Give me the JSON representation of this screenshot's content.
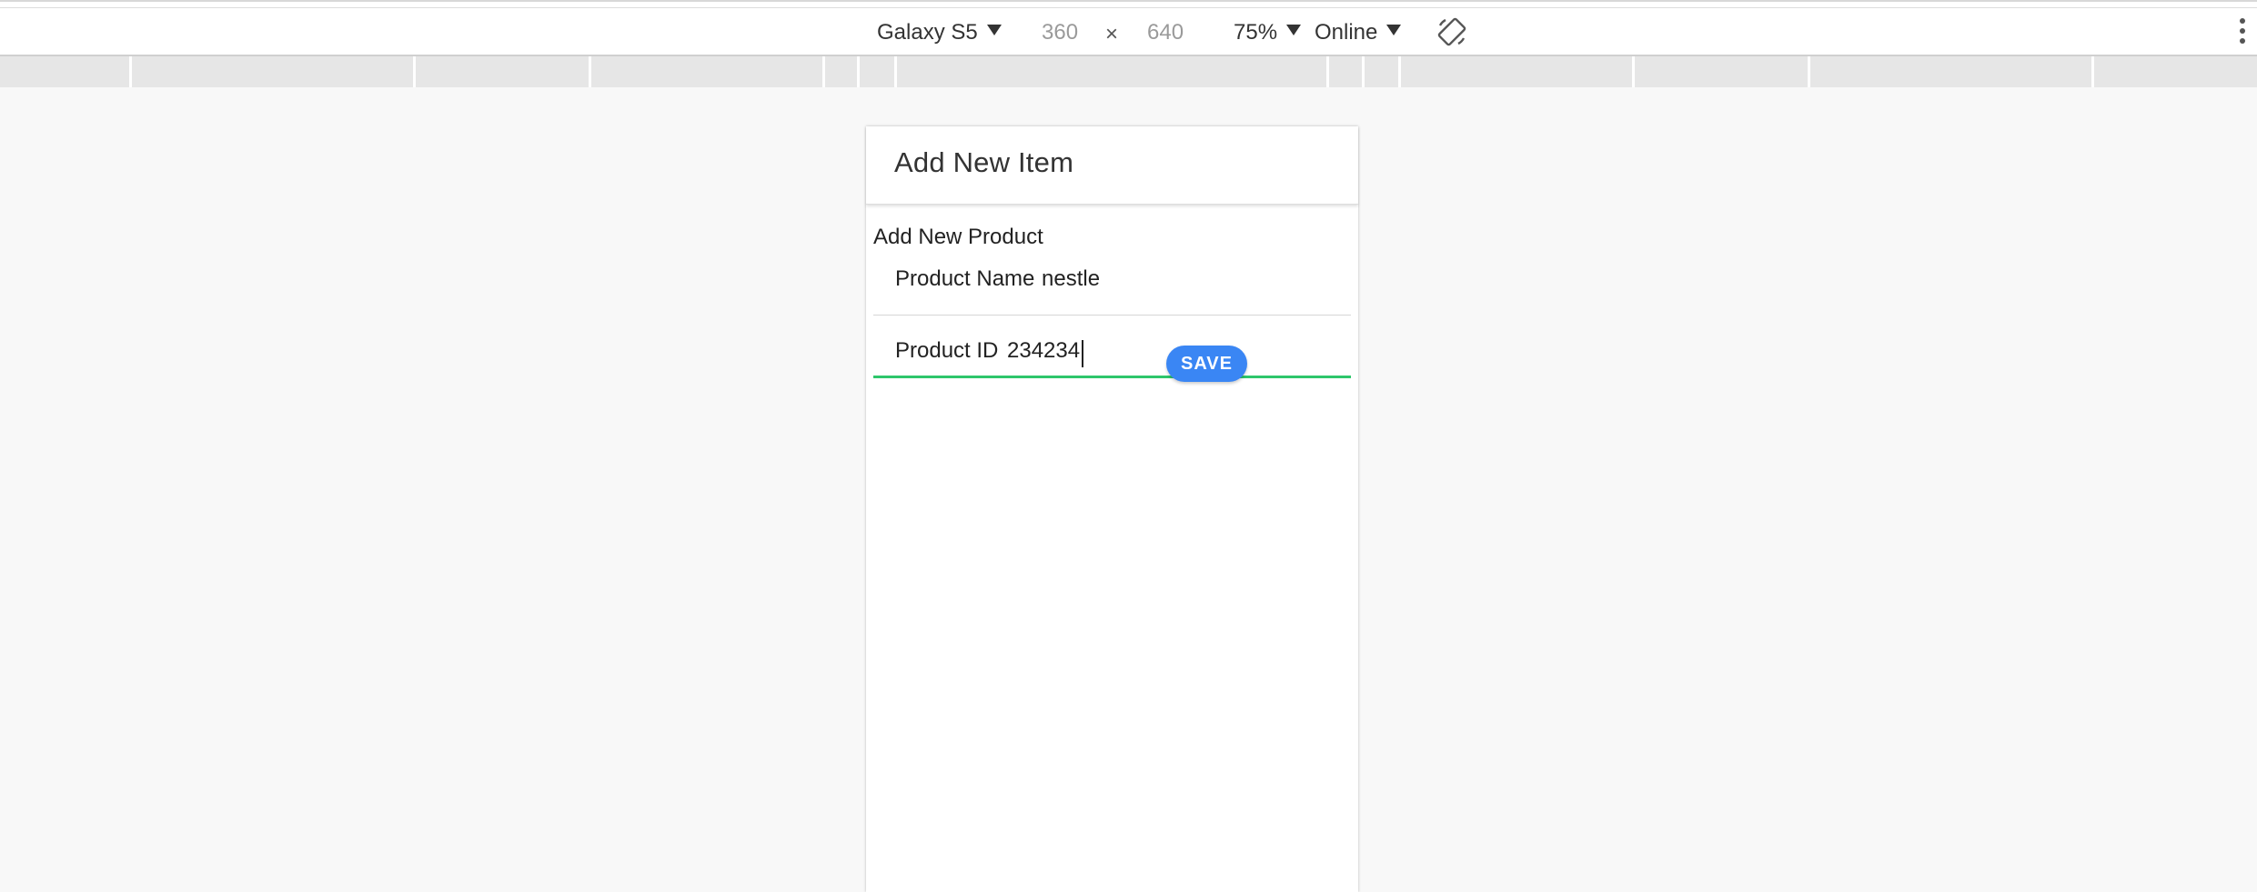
{
  "devtools": {
    "device": "Galaxy S5",
    "width": "360",
    "height": "640",
    "times": "×",
    "zoom": "75%",
    "network": "Online",
    "icons": {
      "rotate": "rotate-icon",
      "more": "more-vertical-icon"
    }
  },
  "app": {
    "header_title": "Add New Item",
    "section_title": "Add New Product",
    "fields": [
      {
        "label": "Product Name",
        "value": "nestle"
      },
      {
        "label": "Product ID",
        "value": "234234"
      }
    ],
    "save_label": "SAVE"
  },
  "colors": {
    "accent_button": "#3a86f4",
    "focus_underline": "#2ec66b"
  }
}
